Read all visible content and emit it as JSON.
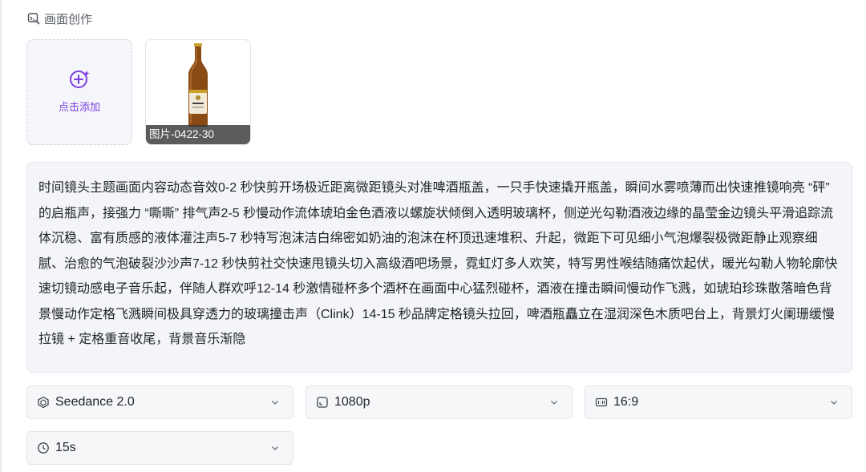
{
  "section": {
    "title": "画面创作",
    "icon": "image-edit-icon"
  },
  "add_card": {
    "label": "点击添加",
    "icon": "add-circle-icon",
    "accent": "#7b3fe4"
  },
  "image_card": {
    "caption": "图片-0422-30"
  },
  "prompt": {
    "text": "时间镜头主题画面内容动态音效0-2 秒快剪开场极近距离微距镜头对准啤酒瓶盖，一只手快速撬开瓶盖，瞬间水雾喷薄而出快速推镜响亮 “砰” 的启瓶声，接强力 “嘶嘶” 排气声2-5 秒慢动作流体琥珀金色酒液以螺旋状倾倒入透明玻璃杯，侧逆光勾勒酒液边缘的晶莹金边镜头平滑追踪流体沉稳、富有质感的液体灌注声5-7 秒特写泡沫洁白绵密如奶油的泡沫在杯顶迅速堆积、升起，微距下可见细小气泡爆裂极微距静止观察细腻、治愈的气泡破裂沙沙声7-12 秒快剪社交快速甩镜头切入高级酒吧场景，霓虹灯多人欢笑，特写男性喉结随痛饮起伏，暖光勾勒人物轮廓快速切镜动感电子音乐起，伴随人群欢呼12-14 秒激情碰杯多个酒杯在画面中心猛烈碰杯，酒液在撞击瞬间慢动作飞溅，如琥珀珍珠散落暗色背景慢动作定格飞溅瞬间极具穿透力的玻璃撞击声（Clink）14-15 秒品牌定格镜头拉回，啤酒瓶矗立在湿润深色木质吧台上，背景灯火阑珊缓慢拉镜 + 定格重音收尾，背景音乐渐隐"
  },
  "settings": {
    "model": {
      "value": "Seedance 2.0",
      "icon": "model-cube-icon"
    },
    "resolution": {
      "value": "1080p",
      "icon": "resolution-icon"
    },
    "ratio": {
      "value": "16:9",
      "icon": "aspect-ratio-icon"
    },
    "duration": {
      "value": "15s",
      "icon": "clock-icon"
    }
  }
}
